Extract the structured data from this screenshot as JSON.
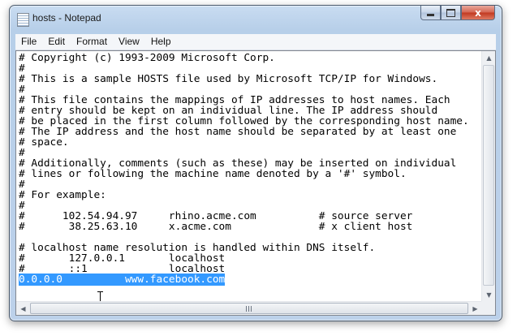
{
  "window": {
    "title": "hosts - Notepad",
    "icon": "notepad-icon",
    "close_glyph": "x"
  },
  "menu": [
    "File",
    "Edit",
    "Format",
    "View",
    "Help"
  ],
  "document": {
    "lines": [
      "# Copyright (c) 1993-2009 Microsoft Corp.",
      "#",
      "# This is a sample HOSTS file used by Microsoft TCP/IP for Windows.",
      "#",
      "# This file contains the mappings of IP addresses to host names. Each",
      "# entry should be kept on an individual line. The IP address should",
      "# be placed in the first column followed by the corresponding host name.",
      "# The IP address and the host name should be separated by at least one",
      "# space.",
      "#",
      "# Additionally, comments (such as these) may be inserted on individual",
      "# lines or following the machine name denoted by a '#' symbol.",
      "#",
      "# For example:",
      "#",
      "#      102.54.94.97     rhino.acme.com          # source server",
      "#       38.25.63.10     x.acme.com              # x client host",
      "",
      "# localhost name resolution is handled within DNS itself.",
      "#       127.0.0.1       localhost",
      "#       ::1             localhost"
    ],
    "selected_line": "0.0.0.0          www.facebook.com"
  },
  "scrollbars": {
    "up_arrow": "▲",
    "down_arrow": "▼",
    "left_arrow": "◀",
    "right_arrow": "▶"
  }
}
